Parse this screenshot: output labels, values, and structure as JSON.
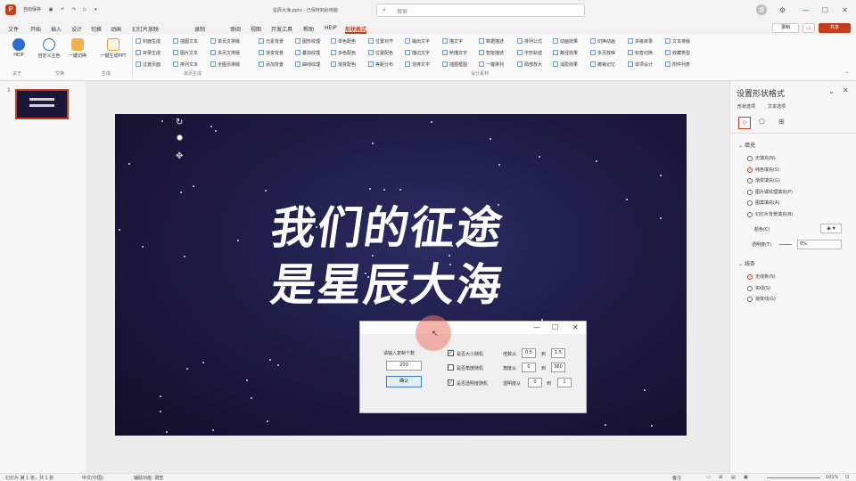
{
  "titlebar": {
    "app_icon": "P",
    "quick_access": [
      "自动保存",
      "开",
      "",
      "",
      "",
      "",
      "",
      "",
      "",
      "",
      "",
      "",
      "",
      "",
      "",
      "",
      "",
      "",
      "",
      "",
      "",
      "",
      "",
      "",
      "",
      "",
      "",
      "",
      "",
      "",
      ""
    ],
    "doc_title": "星辰大海.pptx - 已保存到此电脑",
    "search_placeholder": "搜索",
    "user": "谁",
    "window_controls": [
      "—",
      "☐",
      "✕"
    ]
  },
  "menu": {
    "items": [
      "文件",
      "开始",
      "插入",
      "设计",
      "切换",
      "动画",
      "幻灯片放映",
      "录制",
      "审阅",
      "视图",
      "开发工具",
      "帮助",
      "HEIP",
      "形状格式"
    ],
    "active": "形状格式",
    "record_label": "录制",
    "share_label": "共享"
  },
  "ribbon": {
    "big_buttons": [
      {
        "label": "HEIP",
        "icon": "heip-logo-icon"
      },
      {
        "label": "自定义主色",
        "icon": "palette-icon"
      },
      {
        "label": "一键切换",
        "icon": "cup-icon"
      },
      {
        "label": "一键生成PPT",
        "icon": "ppt-generate-icon"
      }
    ],
    "cells": [
      "封面生成",
      "目录生成",
      "过渡页面",
      "插图文本",
      "图片文本",
      "排列文本",
      "单页文排版",
      "多页文排版",
      "全图页排版",
      "元素背景",
      "渐变背景",
      "添加背景",
      "图形纹理",
      "叠加纹理",
      "曲线纹理",
      "单色配色",
      "多色配色",
      "渐变配色",
      "位置对齐",
      "位置配色",
      "等距分布",
      "输出文字",
      "描边文字",
      "混排文字",
      "描文字",
      "矫描文字",
      "插图框图",
      "数据描述",
      "智能描述",
      "一键排列",
      "排列公式",
      "字形轨迹",
      "局部放大",
      "动画效果",
      "路径效果",
      "消隐效果",
      "切换动画",
      "多页放映",
      "撤销记忆",
      "多级目录",
      "标签切换",
      "单项设计",
      "文本排版",
      "收藏类型",
      "附件列表"
    ],
    "groups": [
      "关于",
      "交换",
      "生成",
      "单页生成",
      "设计素材"
    ]
  },
  "slide_panel": {
    "thumb_number": "1"
  },
  "slide": {
    "line1": "我们的征途",
    "line2": "是星辰大海"
  },
  "dialog": {
    "controls": [
      "—",
      "☐",
      "✕"
    ],
    "prompt": "请输入复制个数",
    "count": "200",
    "ok": "确认",
    "options": [
      {
        "checked": true,
        "label": "是否大小随机",
        "range_label": "倍数从",
        "from": "0.5",
        "to_label": "到",
        "to": "1.5"
      },
      {
        "checked": false,
        "label": "是否角度随机",
        "range_label": "角度从",
        "from": "0",
        "to_label": "到",
        "to": "360"
      },
      {
        "checked": true,
        "label": "是否透明度随机",
        "range_label": "透明度从",
        "from": "0",
        "to_label": "到",
        "to": "1"
      }
    ]
  },
  "format_pane": {
    "title": "设置形状格式",
    "tabs": [
      "形状选项",
      "文本选项"
    ],
    "fill_header": "填充",
    "fill_options": [
      {
        "label": "无填充(N)",
        "selected": false
      },
      {
        "label": "纯色填充(S)",
        "selected": true
      },
      {
        "label": "渐变填充(G)",
        "selected": false
      },
      {
        "label": "图片或纹理填充(P)",
        "selected": false
      },
      {
        "label": "图案填充(A)",
        "selected": false
      },
      {
        "label": "幻灯片背景填充(B)",
        "selected": false
      }
    ],
    "color_label": "颜色(C)",
    "transparency_label": "透明度(T)",
    "transparency_value": "0%",
    "line_header": "线条",
    "line_options": [
      {
        "label": "无线条(N)",
        "selected": true
      },
      {
        "label": "实线(S)",
        "selected": false
      },
      {
        "label": "渐变线(G)",
        "selected": false
      }
    ]
  },
  "statusbar": {
    "slide_info": "幻灯片 第 1 张，共 1 张",
    "language": "中文(中国)",
    "accessibility": "辅助功能: 调查",
    "notes": "备注",
    "zoom": "101%"
  },
  "colors": {
    "accent": "#c43e1c",
    "slide_bg": "#1d1c46"
  }
}
